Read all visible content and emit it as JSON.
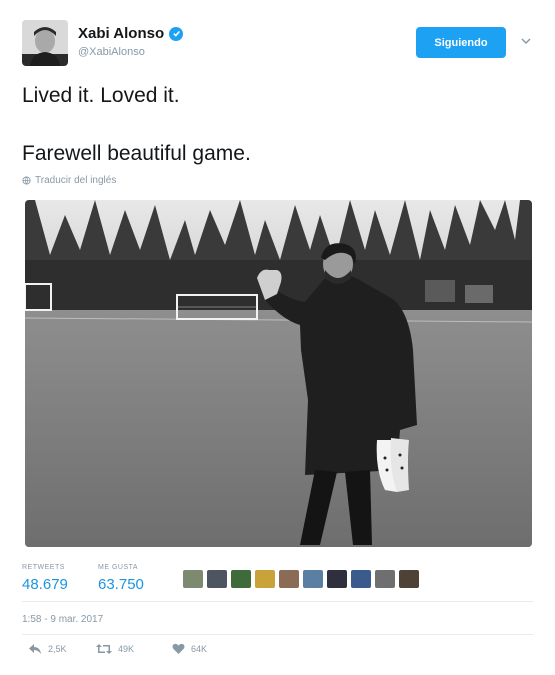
{
  "user": {
    "name": "Xabi Alonso",
    "handle": "@XabiAlonso"
  },
  "follow_button": {
    "label": "Siguiendo"
  },
  "tweet": {
    "line1": "Lived it. Loved it.",
    "line2": "Farewell beautiful game.",
    "translate_label": "Traducir del inglés"
  },
  "stats": {
    "retweets_label": "RETWEETS",
    "retweets_value": "48.679",
    "likes_label": "ME GUSTA",
    "likes_value": "63.750"
  },
  "timestamp": "1:58 - 9 mar. 2017",
  "actions": {
    "reply_count": "2,5K",
    "retweet_count": "49K",
    "like_count": "64K"
  },
  "colors": {
    "accent": "#1da1f2",
    "stat_value": "#1b95e0",
    "muted": "#8899a6"
  },
  "icons": {
    "verified": "verified-badge-icon",
    "chevron": "chevron-down-icon",
    "translate": "globe-icon",
    "reply": "reply-icon",
    "retweet": "retweet-icon",
    "like": "heart-icon"
  }
}
